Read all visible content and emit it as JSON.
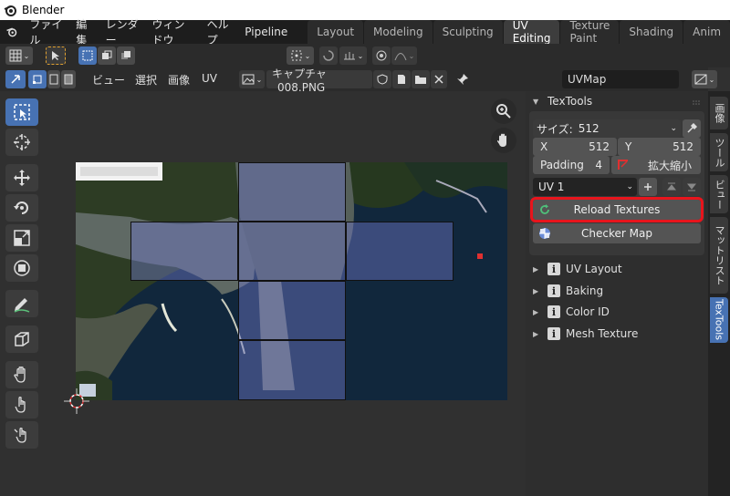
{
  "window": {
    "title": "Blender"
  },
  "menu": {
    "items": [
      "ファイル",
      "編集",
      "レンダー",
      "ウィンドウ",
      "ヘルプ",
      "Pipeline"
    ]
  },
  "workspace_tabs": [
    {
      "label": "Layout",
      "active": false
    },
    {
      "label": "Modeling",
      "active": false
    },
    {
      "label": "Sculpting",
      "active": false
    },
    {
      "label": "UV Editing",
      "active": true
    },
    {
      "label": "Texture Paint",
      "active": false
    },
    {
      "label": "Shading",
      "active": false
    },
    {
      "label": "Anim",
      "active": false
    }
  ],
  "uv_header": {
    "menus": [
      "ビュー",
      "選択",
      "画像",
      "UV"
    ],
    "image_name": "キャプチャ_008.PNG",
    "uvmap_name": "UVMap"
  },
  "sidebar": {
    "panel_title": "TexTools",
    "size_label": "サイズ:",
    "size_value": "512",
    "x_label": "X",
    "x_value": "512",
    "y_label": "Y",
    "y_value": "512",
    "padding_label": "Padding",
    "padding_value": "4",
    "scale_label": "拡大縮小",
    "uv_channel": "UV 1",
    "reload_label": "Reload Textures",
    "checker_label": "Checker Map",
    "subpanels": [
      "UV Layout",
      "Baking",
      "Color ID",
      "Mesh Texture"
    ]
  },
  "vertical_tabs": [
    "画像",
    "ツール",
    "ビュー",
    "マットリスト",
    "TexTools"
  ],
  "colors": {
    "accent": "#4772b3",
    "highlight": "#e8141c",
    "background": "#303030"
  }
}
